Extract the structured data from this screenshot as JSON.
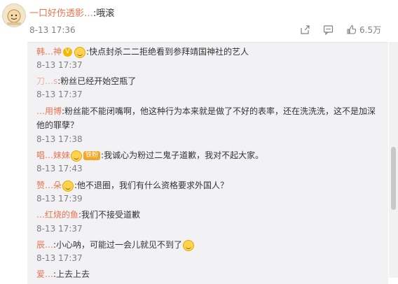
{
  "post": {
    "author": "一口好伤透影…",
    "text": ":哦滚",
    "time": "8-13 17:36",
    "like_count": "6.5万"
  },
  "comments": [
    {
      "name": "韩…神",
      "text": ":快点封杀二二拒绝看到参拜靖国神社的艺人",
      "time": "8-13 17:37"
    },
    {
      "name": "刀…s",
      "text": ":粉丝已经开始空瓶了",
      "time": "8-13 17:37"
    },
    {
      "name": "…用博",
      "text": ":粉丝能不能闭嘴啊，他这种行为本来就是做了不好的表率，还在洗洗洗，这不是加深他的罪孽？",
      "time": "8-13 17:38"
    },
    {
      "name": "唱…妹妹",
      "text": ":我诚心为粉过二鬼子道歉，我对不起大家。",
      "time": "8-13 17:43"
    },
    {
      "name": "赞…朵",
      "text": ":他不退圈，我们有什么资格要求外国人？",
      "time": "8-13 17:39"
    },
    {
      "name": "…红烧的鱼",
      "text": ":我们不接受道歉",
      "time": "8-13 17:37"
    },
    {
      "name": "辰…",
      "text": ":小心呐，可能过一会儿就见不到了",
      "time": "8-13 17:37"
    },
    {
      "name": "爱…",
      "text": ":上去上去",
      "time": ""
    }
  ],
  "badges": {
    "verified": "V",
    "fan": "铁粉"
  },
  "colors": {
    "accent": "#eb7350",
    "meta": "#808080",
    "panel": "#f2f2f5"
  },
  "icons": [
    "share-icon",
    "comment-icon",
    "like-icon",
    "verified-icon",
    "emoji-icon"
  ]
}
